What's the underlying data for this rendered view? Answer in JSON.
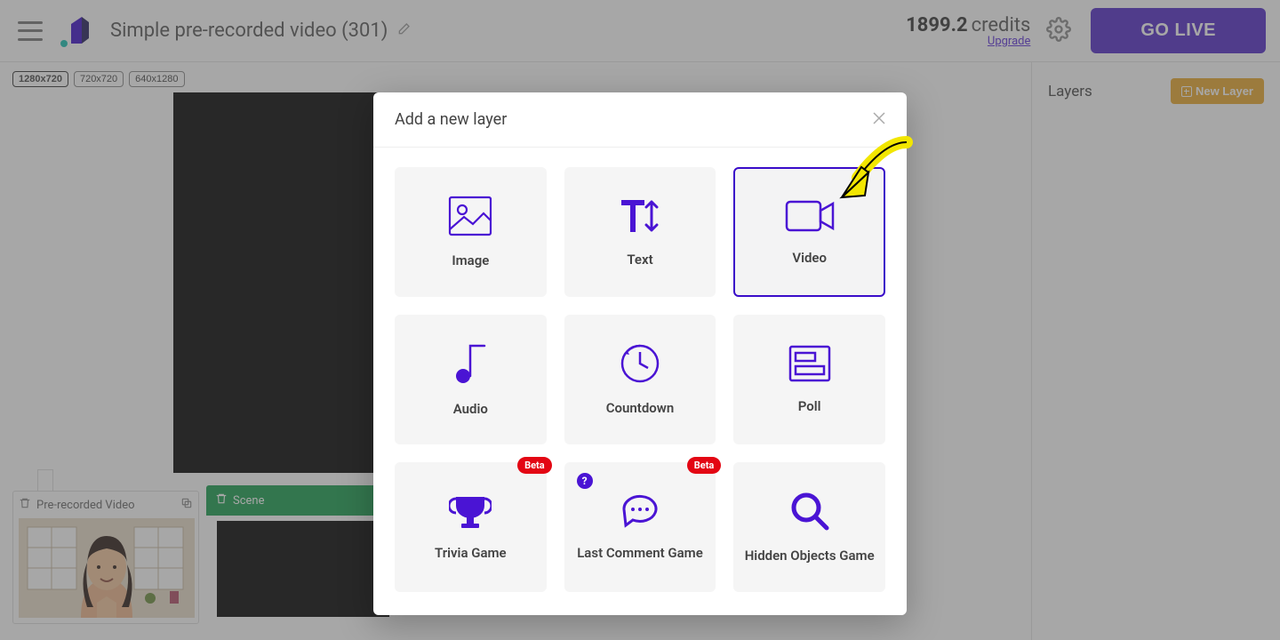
{
  "header": {
    "title": "Simple pre-recorded video (301)",
    "credits_amount": "1899.2",
    "credits_label": "credits",
    "upgrade": "Upgrade",
    "go_live": "GO LIVE"
  },
  "resolutions": {
    "r1": "1280x720",
    "r2": "720x720",
    "r3": "640x1280"
  },
  "right": {
    "layers_title": "Layers",
    "new_layer": "New Layer"
  },
  "scenes": {
    "prerecorded": "Pre-recorded Video",
    "scene": "Scene"
  },
  "modal": {
    "title": "Add a new layer",
    "tiles": {
      "image": "Image",
      "text": "Text",
      "video": "Video",
      "audio": "Audio",
      "countdown": "Countdown",
      "poll": "Poll",
      "trivia": "Trivia Game",
      "last_comment": "Last Comment Game",
      "hidden_objects": "Hidden Objects Game"
    },
    "badge_beta": "Beta",
    "help": "?"
  }
}
